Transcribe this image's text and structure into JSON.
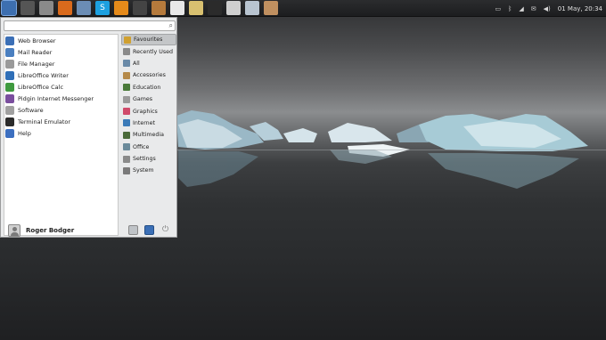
{
  "panel": {
    "launchers": [
      {
        "name": "whisker-menu-icon",
        "glyph": "",
        "color": "#3d6fb0",
        "active": true
      },
      {
        "name": "disc-icon",
        "glyph": "",
        "color": "#555",
        "active": false
      },
      {
        "name": "files-icon",
        "glyph": "",
        "color": "#8a8a8a",
        "active": false
      },
      {
        "name": "firefox-icon",
        "glyph": "",
        "color": "#d96a1c",
        "active": false
      },
      {
        "name": "settings-icon",
        "glyph": "",
        "color": "#6b8db5",
        "active": false
      },
      {
        "name": "skype-icon",
        "glyph": "S",
        "color": "#1ca0e0",
        "active": false
      },
      {
        "name": "vlc-icon",
        "glyph": "",
        "color": "#e58a1a",
        "active": false
      },
      {
        "name": "paint-icon",
        "glyph": "",
        "color": "#444",
        "active": false
      },
      {
        "name": "image-viewer-icon",
        "glyph": "",
        "color": "#b57a3c",
        "active": false
      },
      {
        "name": "document-icon",
        "glyph": "",
        "color": "#e8e8e8",
        "active": false
      },
      {
        "name": "notes-icon",
        "glyph": "",
        "color": "#d8c070",
        "active": false
      },
      {
        "name": "terminal-icon",
        "glyph": "",
        "color": "#2b2b2b",
        "active": false
      },
      {
        "name": "calculator-icon",
        "glyph": "",
        "color": "#cfcfcf",
        "active": false
      },
      {
        "name": "screenshot-icon",
        "glyph": "",
        "color": "#b8c4d0",
        "active": false
      },
      {
        "name": "archive-icon",
        "glyph": "",
        "color": "#c09060",
        "active": false
      }
    ],
    "tray": {
      "battery_icon": "battery-icon",
      "bluetooth_icon": "bluetooth-icon",
      "network_icon": "network-icon",
      "mail_icon": "mail-icon",
      "volume_icon": "volume-icon",
      "clock": "01 May, 20:34"
    }
  },
  "menu": {
    "search": {
      "value": "",
      "placeholder": ""
    },
    "favourites": [
      {
        "label": "Web Browser",
        "icon": "globe-icon",
        "color": "#3b6fb6"
      },
      {
        "label": "Mail Reader",
        "icon": "mail-icon",
        "color": "#4a7fc0"
      },
      {
        "label": "File Manager",
        "icon": "folder-icon",
        "color": "#9a9a9a"
      },
      {
        "label": "LibreOffice Writer",
        "icon": "writer-icon",
        "color": "#2f6fb8"
      },
      {
        "label": "LibreOffice Calc",
        "icon": "calc-icon",
        "color": "#3f9a3f"
      },
      {
        "label": "Pidgin Internet Messenger",
        "icon": "pidgin-icon",
        "color": "#7a4e9e"
      },
      {
        "label": "Software",
        "icon": "software-icon",
        "color": "#a0a0a0"
      },
      {
        "label": "Terminal Emulator",
        "icon": "terminal-icon",
        "color": "#2b2b2b"
      },
      {
        "label": "Help",
        "icon": "help-icon",
        "color": "#3c6fc0"
      }
    ],
    "categories": [
      {
        "label": "Favourites",
        "icon": "star-icon",
        "color": "#d0a030",
        "selected": true
      },
      {
        "label": "Recently Used",
        "icon": "clock-icon",
        "color": "#8a8a8a",
        "selected": false
      },
      {
        "label": "All",
        "icon": "all-icon",
        "color": "#6a8aa8",
        "selected": false
      },
      {
        "label": "Accessories",
        "icon": "accessories-icon",
        "color": "#b58a4a",
        "selected": false
      },
      {
        "label": "Education",
        "icon": "education-icon",
        "color": "#4a7a3a",
        "selected": false
      },
      {
        "label": "Games",
        "icon": "games-icon",
        "color": "#9a9a9a",
        "selected": false
      },
      {
        "label": "Graphics",
        "icon": "graphics-icon",
        "color": "#d04a6a",
        "selected": false
      },
      {
        "label": "Internet",
        "icon": "internet-icon",
        "color": "#3a7ab8",
        "selected": false
      },
      {
        "label": "Multimedia",
        "icon": "multimedia-icon",
        "color": "#4a6a3a",
        "selected": false
      },
      {
        "label": "Office",
        "icon": "office-icon",
        "color": "#6a8a9a",
        "selected": false
      },
      {
        "label": "Settings",
        "icon": "settings-icon",
        "color": "#8a8a8a",
        "selected": false
      },
      {
        "label": "System",
        "icon": "system-icon",
        "color": "#7a7a7a",
        "selected": false
      }
    ],
    "footer": {
      "user_name": "Roger Bodger",
      "buttons": [
        "settings-manager-icon",
        "lock-screen-icon",
        "logout-icon"
      ]
    }
  }
}
